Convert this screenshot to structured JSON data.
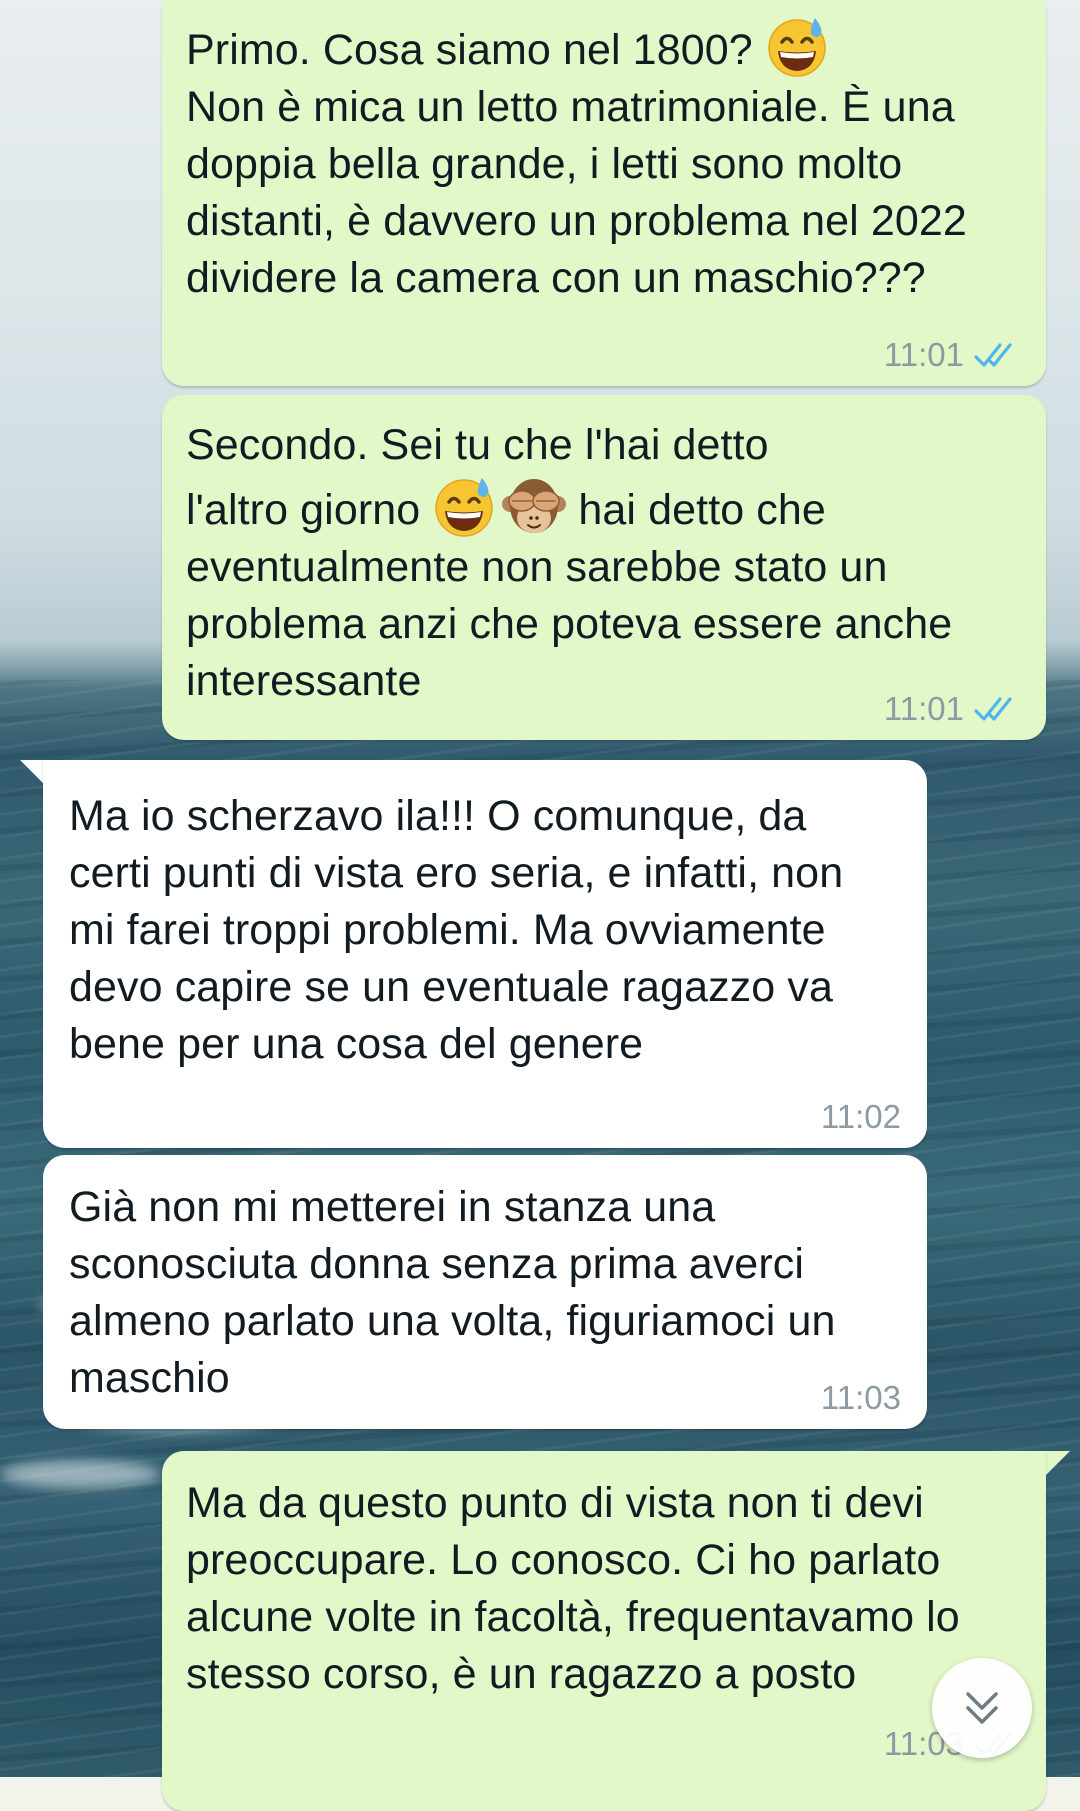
{
  "theme": {
    "outgoing_bubble": "#e3f8c9",
    "incoming_bubble": "#ffffff",
    "read_ticks": "#4fb6ec",
    "meta_text": "#8c9aa1"
  },
  "messages": [
    {
      "direction": "outgoing",
      "line1": "Primo. Cosa siamo nel 1800? ",
      "emoji1": "grinning-face-with-sweat",
      "rest": "Non è mica un letto matrimoniale. È una doppia bella grande, i letti sono molto distanti, è davvero un problema nel 2022 dividere la camera con un maschio???",
      "time": "11:01",
      "status": "read"
    },
    {
      "direction": "outgoing",
      "line1": "Secondo. Sei tu che l'hai detto",
      "line2_before": "l'altro giorno ",
      "emoji1": "grinning-face-with-sweat",
      "emoji2": "see-no-evil-monkey",
      "line2_after": " hai detto che",
      "rest": "eventualmente non sarebbe stato un problema anzi che poteva essere anche interessante",
      "time": "11:01",
      "status": "read"
    },
    {
      "direction": "incoming",
      "text": "Ma io scherzavo ila!!! O comunque, da certi punti di vista ero seria, e infatti, non mi farei troppi problemi. Ma ovviamente devo capire se un eventuale ragazzo va bene per una cosa del genere",
      "time": "11:02"
    },
    {
      "direction": "incoming",
      "text": "Già non mi metterei in stanza una sconosciuta donna senza prima averci almeno parlato una volta, figuriamoci un maschio",
      "time": "11:03"
    },
    {
      "direction": "outgoing",
      "text": "Ma da questo punto di vista non ti devi preoccupare. Lo conosco. Ci ho parlato alcune volte in facoltà, frequentavamo lo stesso corso, è un ragazzo a posto",
      "time": "11:03",
      "status": "read"
    }
  ],
  "scroll_button_icon": "double-chevron-down-icon"
}
